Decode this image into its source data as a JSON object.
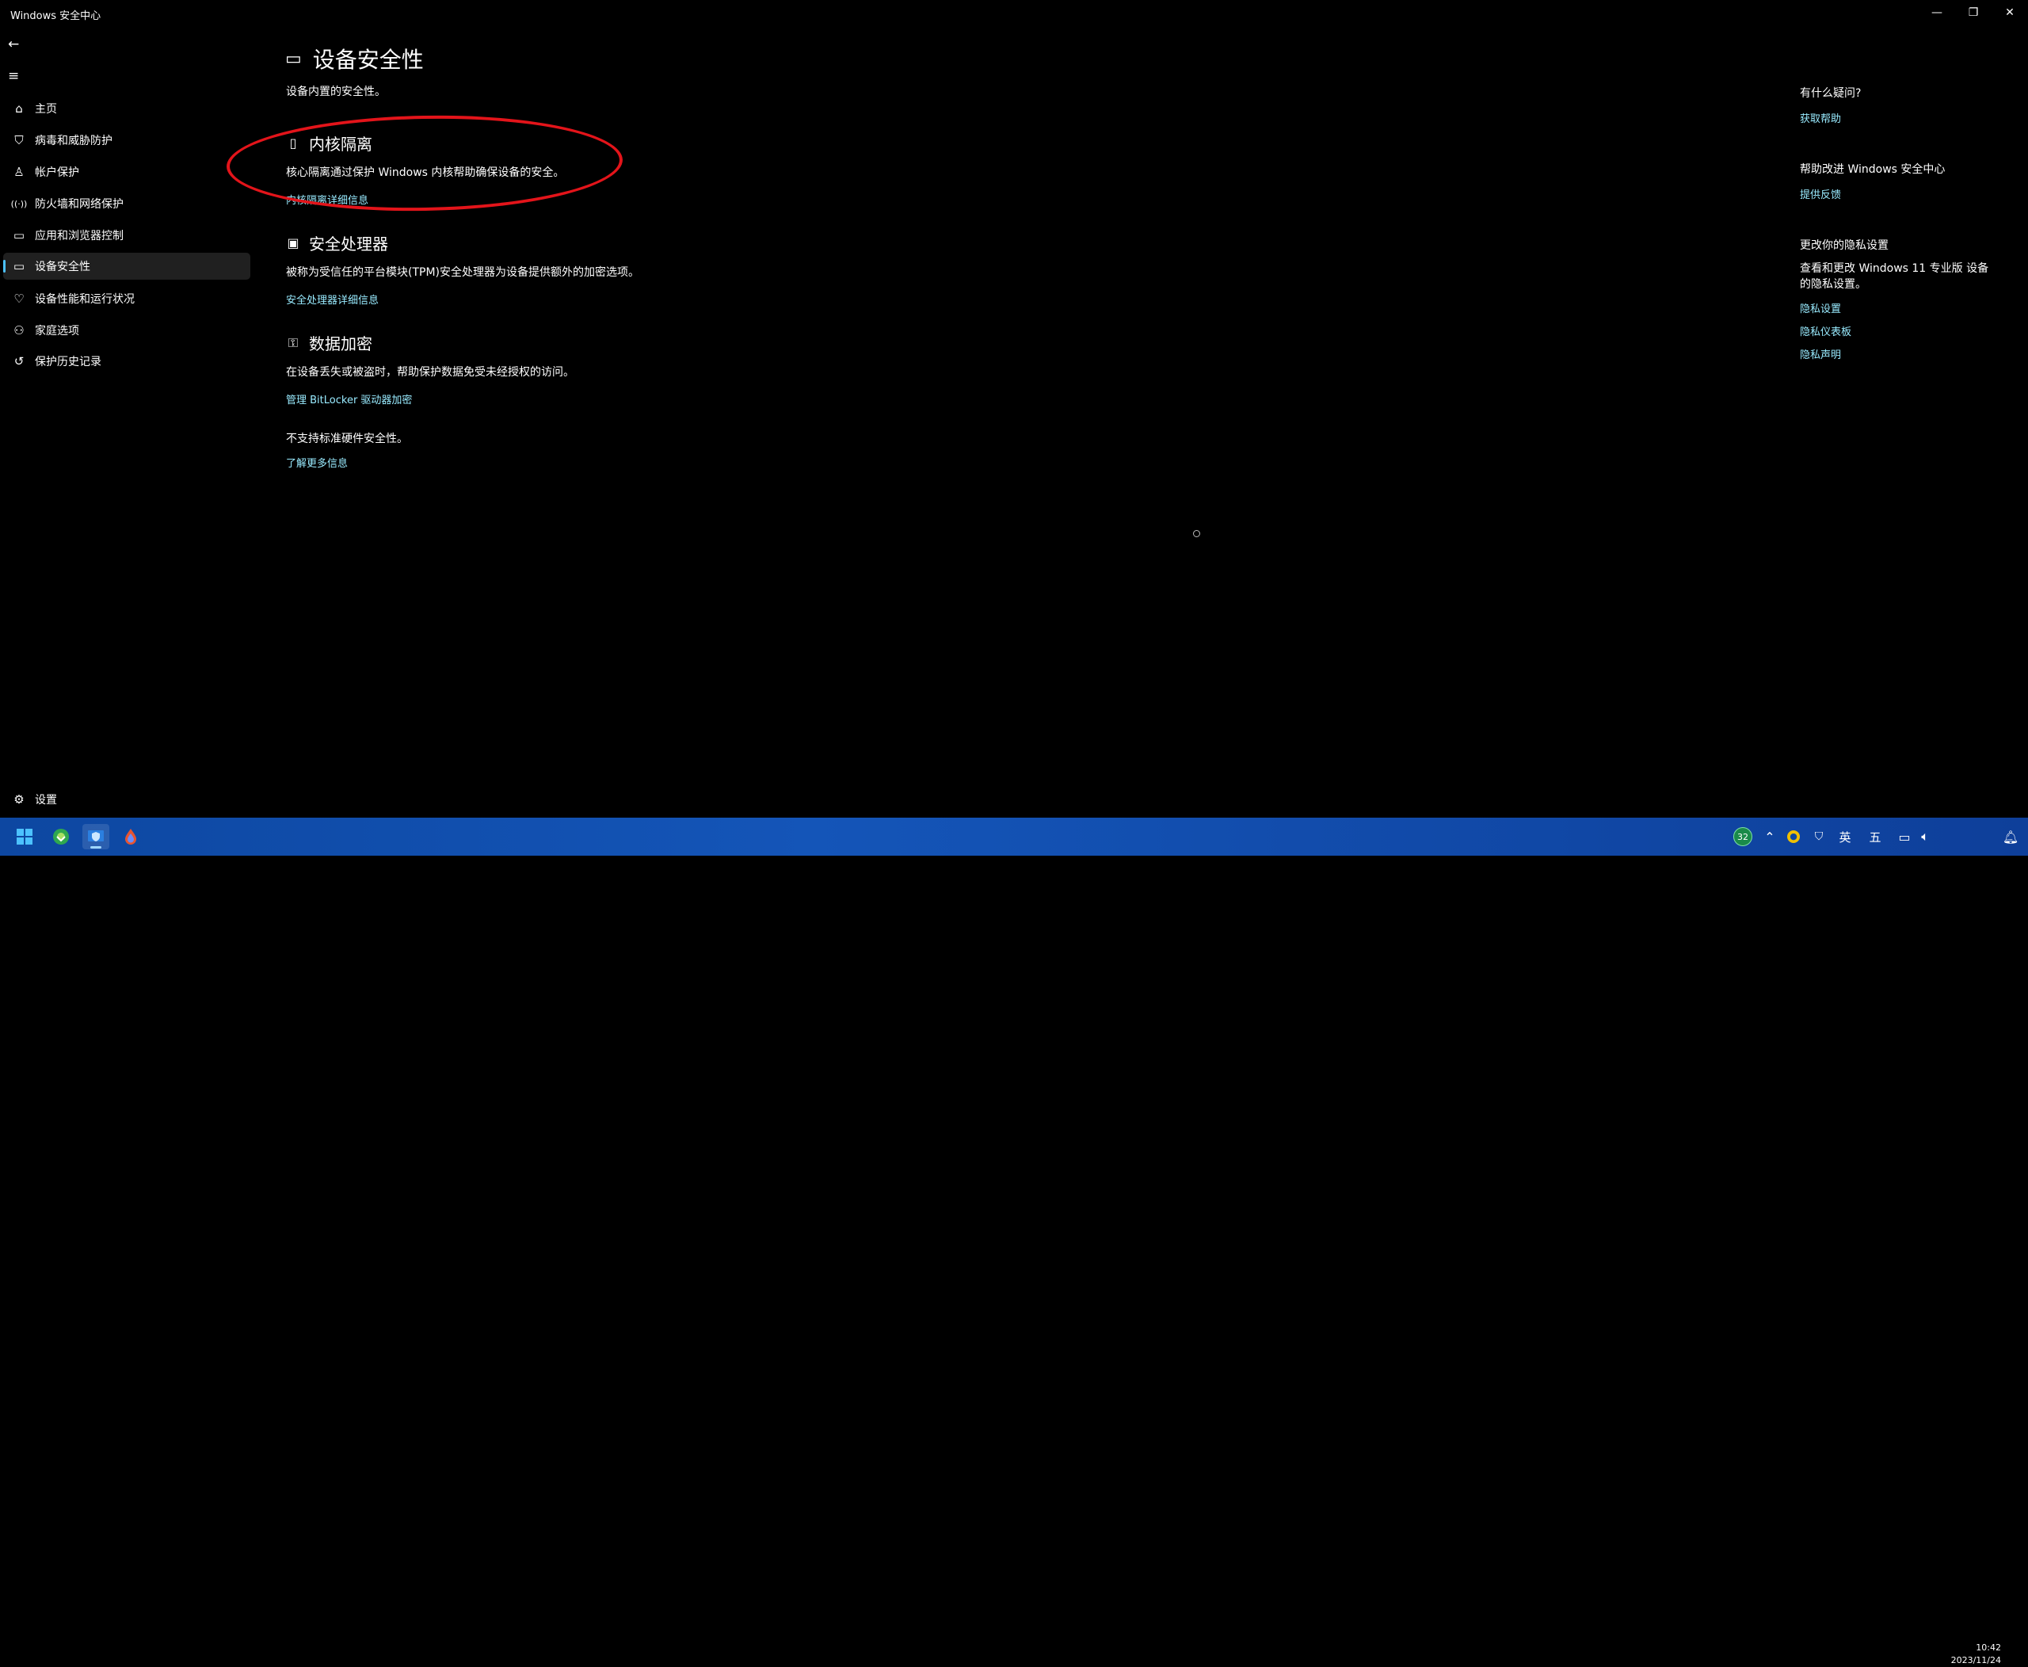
{
  "window": {
    "title": "Windows 安全中心",
    "min": "—",
    "max": "❐",
    "close": "✕"
  },
  "sidebar": {
    "items": [
      {
        "label": "主页",
        "icon": "home-icon",
        "glyph": "⌂"
      },
      {
        "label": "病毒和威胁防护",
        "icon": "shield-icon",
        "glyph": "⛉"
      },
      {
        "label": "帐户保护",
        "icon": "person-icon",
        "glyph": "♙"
      },
      {
        "label": "防火墙和网络保护",
        "icon": "antenna-icon",
        "glyph": "((·))"
      },
      {
        "label": "应用和浏览器控制",
        "icon": "app-window-icon",
        "glyph": "▭"
      },
      {
        "label": "设备安全性",
        "icon": "laptop-icon",
        "glyph": "▭"
      },
      {
        "label": "设备性能和运行状况",
        "icon": "heart-icon",
        "glyph": "♡"
      },
      {
        "label": "家庭选项",
        "icon": "family-icon",
        "glyph": "⚇"
      },
      {
        "label": "保护历史记录",
        "icon": "history-icon",
        "glyph": "↺"
      }
    ],
    "settings_label": "设置"
  },
  "main": {
    "title": "设备安全性",
    "subtitle": "设备内置的安全性。",
    "sections": [
      {
        "heading": "内核隔离",
        "desc": "核心隔离通过保护 Windows 内核帮助确保设备的安全。",
        "link": "内核隔离详细信息",
        "icon": "core-isolation-icon"
      },
      {
        "heading": "安全处理器",
        "desc": "被称为受信任的平台模块(TPM)安全处理器为设备提供额外的加密选项。",
        "link": "安全处理器详细信息",
        "icon": "chip-icon"
      },
      {
        "heading": "数据加密",
        "desc": "在设备丢失或被盗时，帮助保护数据免受未经授权的访问。",
        "link": "管理 BitLocker 驱动器加密",
        "icon": "key-icon"
      }
    ],
    "note": "不支持标准硬件安全性。",
    "note_link": "了解更多信息"
  },
  "right_panel": {
    "help_title": "有什么疑问?",
    "help_link": "获取帮助",
    "improve_title": "帮助改进 Windows 安全中心",
    "feedback_link": "提供反馈",
    "privacy_title": "更改你的隐私设置",
    "privacy_text": "查看和更改 Windows 11 专业版 设备的隐私设置。",
    "privacy_links": [
      "隐私设置",
      "隐私仪表板",
      "隐私声明"
    ]
  },
  "taskbar": {
    "badge": "32",
    "lang": "英",
    "ime": "五",
    "time": "10:42",
    "date": "2023/11/24"
  },
  "colors": {
    "accent": "#4cc2ff",
    "link": "#99ebff",
    "annotation": "#e3141a"
  }
}
